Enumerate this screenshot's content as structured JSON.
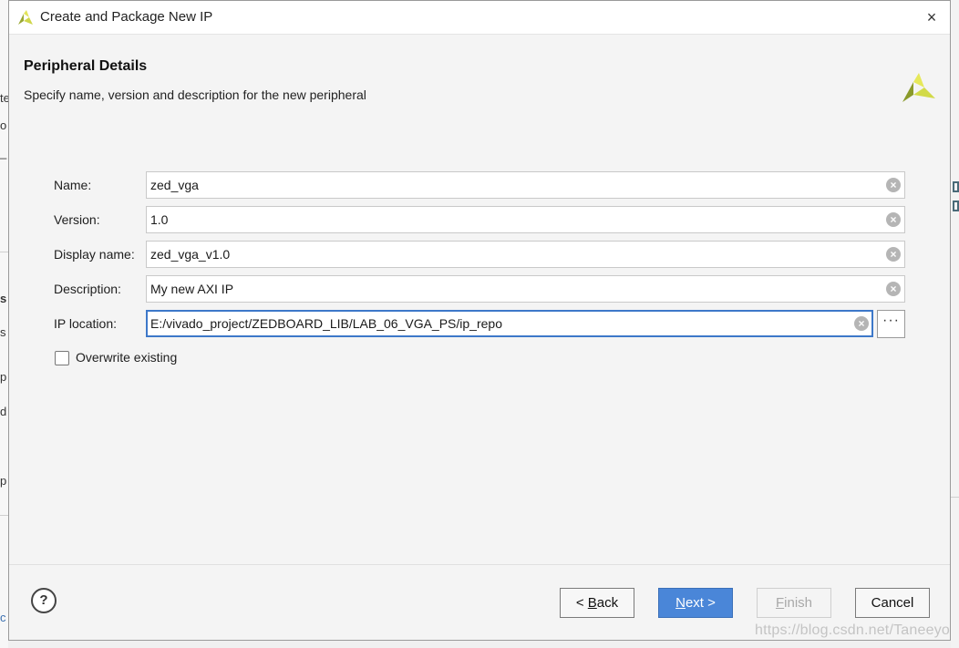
{
  "dialog": {
    "title": "Create and Package New IP",
    "close_icon": "×"
  },
  "header": {
    "title": "Peripheral Details",
    "subtitle": "Specify name, version and description for the new peripheral"
  },
  "form": {
    "name": {
      "label": "Name:",
      "value": "zed_vga"
    },
    "version": {
      "label": "Version:",
      "value": "1.0"
    },
    "display_name": {
      "label": "Display name:",
      "value": "zed_vga_v1.0"
    },
    "description": {
      "label": "Description:",
      "value": "My new AXI IP"
    },
    "ip_location": {
      "label": "IP location:",
      "value": "E:/vivado_project/ZEDBOARD_LIB/LAB_06_VGA_PS/ip_repo"
    },
    "browse_label": "···",
    "overwrite": {
      "label": "Overwrite existing",
      "checked": false
    },
    "clear_glyph": "×"
  },
  "footer": {
    "help": "?",
    "back_prefix": "< ",
    "back_key": "B",
    "back_rest": "ack",
    "next_key": "N",
    "next_rest": "ext >",
    "finish_key": "F",
    "finish_rest": "inish",
    "cancel": "Cancel"
  },
  "background": {
    "left_fragments": [
      "te",
      "o",
      "_",
      "s",
      "s",
      "p",
      "d",
      "p",
      "c"
    ]
  },
  "watermark": "https://blog.csdn.net/Taneeyo",
  "colors": {
    "accent": "#4a86d8",
    "logo_light": "#d9df4a",
    "logo_dark": "#8a9a2a"
  }
}
